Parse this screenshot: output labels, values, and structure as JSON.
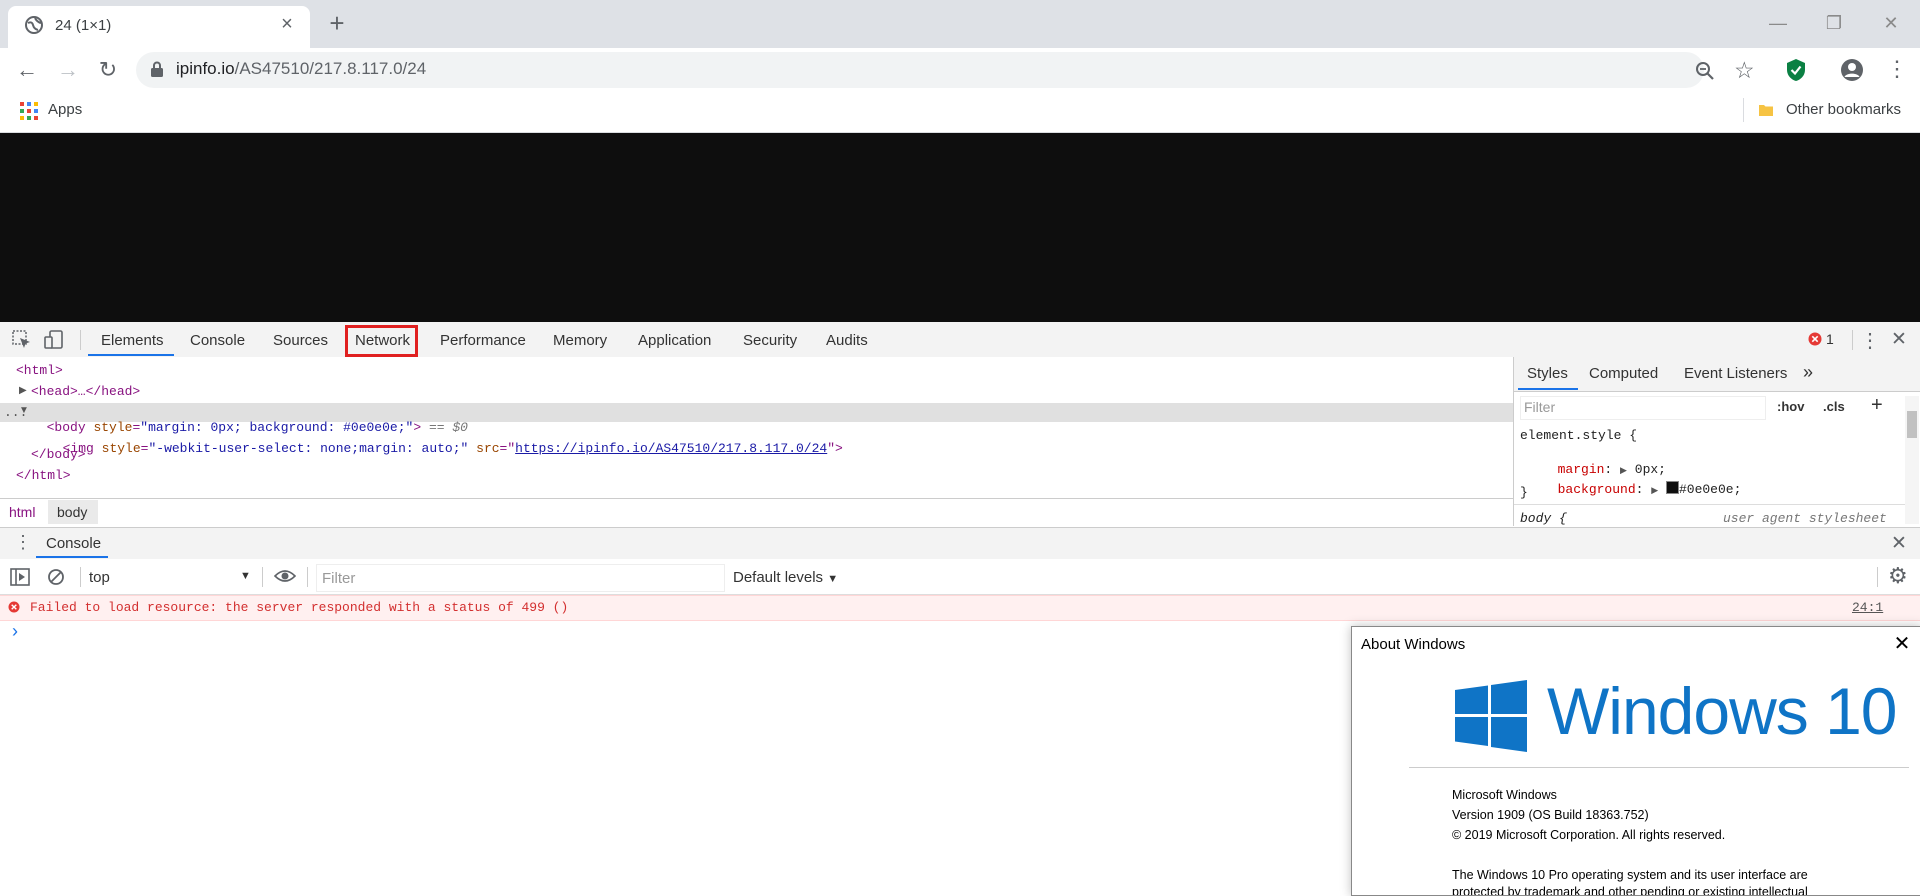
{
  "browser": {
    "tab_title": "24 (1×1)",
    "url_host": "ipinfo.io",
    "url_path": "/AS47510/217.8.117.0/24",
    "bookmarks": {
      "apps": "Apps",
      "other": "Other bookmarks"
    }
  },
  "devtools": {
    "tabs": [
      "Elements",
      "Console",
      "Sources",
      "Network",
      "Performance",
      "Memory",
      "Application",
      "Security",
      "Audits"
    ],
    "error_count": "1",
    "dom": {
      "html_open": "<html>",
      "head": "<head>…</head>",
      "body_tag_open": "<body",
      "body_style_attr": "style",
      "body_style_val": "\"margin: 0px; background: #0e0e0e;\"",
      "body_tag_close": ">",
      "body_selected_marker": "== $0",
      "img_tag_open": "<img",
      "img_style_attr": "style",
      "img_style_val": "\"-webkit-user-select: none;margin: auto;\"",
      "img_src_attr": "src",
      "img_src_val": "https://ipinfo.io/AS47510/217.8.117.0/24",
      "img_tag_close": ">",
      "body_close": "</body>",
      "html_close": "</html>",
      "dots": "..."
    },
    "breadcrumb": [
      "html",
      "body"
    ],
    "styles": {
      "tabs": [
        "Styles",
        "Computed",
        "Event Listeners"
      ],
      "filter_placeholder": "Filter",
      "hov": ":hov",
      "cls": ".cls",
      "element_style_open": "element.style {",
      "prop_margin": "margin",
      "val_margin": "0px;",
      "prop_background": "background",
      "val_background": "#0e0e0e;",
      "close_brace": "}",
      "body_rule": "body {",
      "user_agent": "user agent stylesheet"
    },
    "console": {
      "drawer_title": "Console",
      "context": "top",
      "filter_placeholder": "Filter",
      "levels": "Default levels",
      "error_message": "Failed to load resource: the server responded with a status of 499 ()",
      "error_source": "24:1",
      "prompt": "›"
    }
  },
  "about": {
    "title": "About Windows",
    "wordmark": "Windows 10",
    "line1": "Microsoft Windows",
    "line2": "Version 1909 (OS Build 18363.752)",
    "line3": "© 2019 Microsoft Corporation. All rights reserved.",
    "line4": "The Windows 10 Pro operating system and its user interface are",
    "line5": "protected by trademark and other pending or existing intellectual"
  },
  "colors": {
    "page_background": "#0e0e0e",
    "highlight_red": "#e02020",
    "windows_blue": "#0f74c6",
    "selected_tab": "#1a73e8"
  }
}
